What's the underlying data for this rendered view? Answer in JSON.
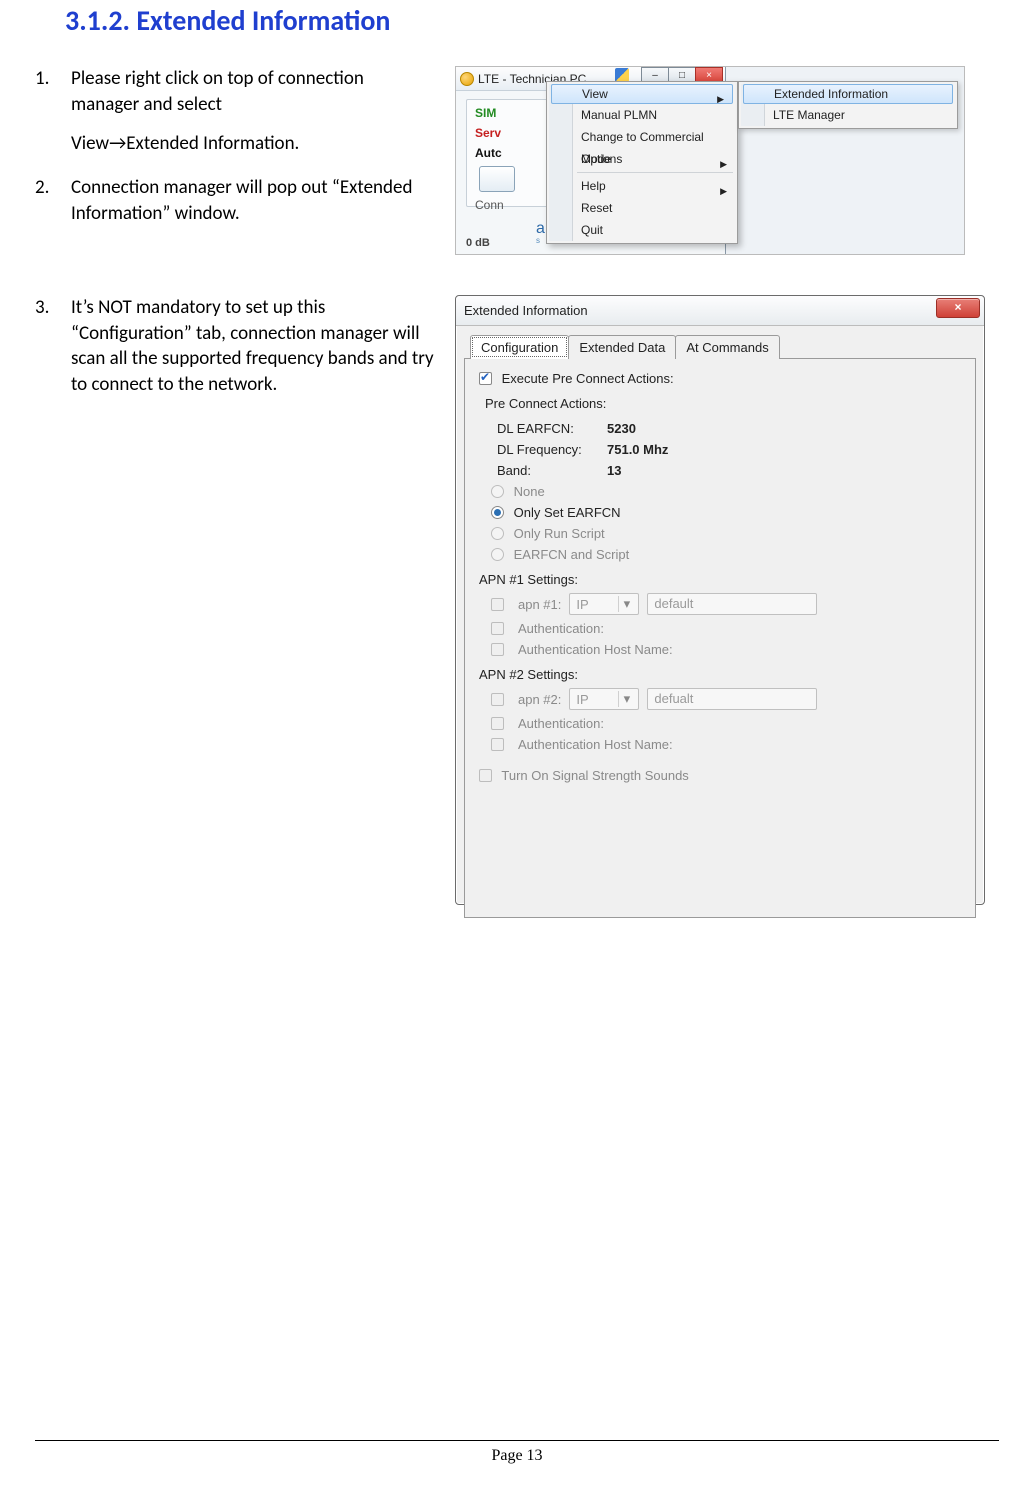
{
  "heading": {
    "number": "3.1.2.",
    "title": "Extended Information"
  },
  "steps": [
    {
      "num": "1.",
      "text": "Please right click on top of connection manager and select",
      "subline": "View→Extended Information."
    },
    {
      "num": "2.",
      "text": "Connection manager will pop out “Extended Information” window."
    },
    {
      "num": "3.",
      "text": "It’s NOT mandatory to set up this “Configuration” tab, connection manager will scan all the supported frequency bands and try to connect to the network."
    }
  ],
  "shot1": {
    "app_title": "LTE - Technician PC",
    "win_min": "–",
    "win_max": "□",
    "win_close": "×",
    "labels": {
      "sim": "SIM",
      "serv": "Serv",
      "auto": "Autc",
      "conn": "Conn"
    },
    "brand": "a l t a i r",
    "brand_sub": "s e m i c o n d u c t o r",
    "db": "0 dB",
    "menu": {
      "view": "View",
      "manual_plmn": "Manual PLMN",
      "commercial": "Change to Commercial Mode",
      "options": "Options",
      "help": "Help",
      "reset": "Reset",
      "quit": "Quit",
      "arrow": "▶"
    },
    "submenu": {
      "ext_info": "Extended Information",
      "lte_mgr": "LTE Manager"
    }
  },
  "shot2": {
    "title": "Extended Information",
    "close": "×",
    "tabs": {
      "config": "Configuration",
      "ext_data": "Extended Data",
      "at_cmd": "At Commands"
    },
    "execute_pre": "Execute Pre Connect Actions:",
    "pre_connect_actions": "Pre Connect Actions:",
    "dl_earfcn_label": "DL EARFCN:",
    "dl_earfcn_value": "5230",
    "dl_freq_label": "DL Frequency:",
    "dl_freq_value": "751.0 Mhz",
    "band_label": "Band:",
    "band_value": "13",
    "radio_none": "None",
    "radio_only_earfcn": "Only Set EARFCN",
    "radio_only_script": "Only Run Script",
    "radio_both": "EARFCN and Script",
    "apn1_header": "APN #1 Settings:",
    "apn1_label": "apn #1:",
    "apn2_header": "APN #2 Settings:",
    "apn2_label": "apn #2:",
    "ip_option": "IP",
    "apn1_default": "default",
    "apn2_default": "defualt",
    "auth": "Authentication:",
    "auth_host": "Authentication Host Name:",
    "sounds": "Turn On Signal Strength Sounds",
    "caret": "▾"
  },
  "footer": "Page 13"
}
